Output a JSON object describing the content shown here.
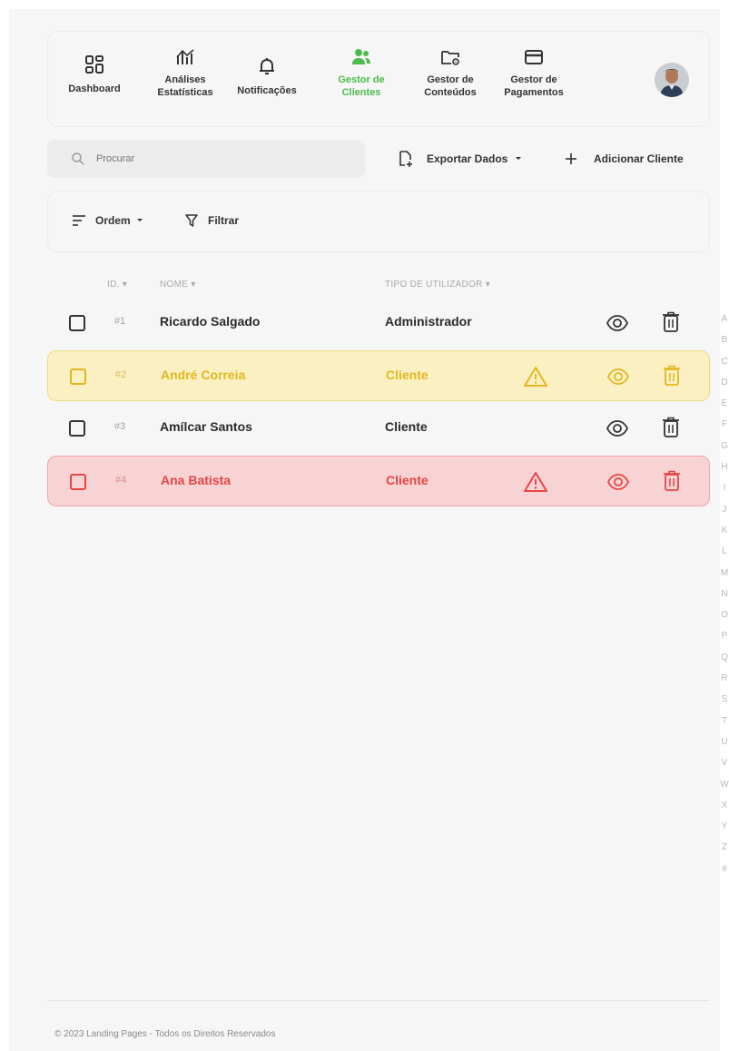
{
  "nav": {
    "items": [
      {
        "label_1": "Dashboard",
        "label_2": "",
        "icon": "dashboard-grid-icon",
        "active": false
      },
      {
        "label_1": "Análises",
        "label_2": "Estatísticas",
        "icon": "analytics-icon",
        "active": false
      },
      {
        "label_1": "Notificações",
        "label_2": "",
        "icon": "bell-icon",
        "active": false
      },
      {
        "label_1": "Gestor de",
        "label_2": "Clientes",
        "icon": "users-icon",
        "active": true
      },
      {
        "label_1": "Gestor de",
        "label_2": "Conteúdos",
        "icon": "folder-settings-icon",
        "active": false
      },
      {
        "label_1": "Gestor de",
        "label_2": "Pagamentos",
        "icon": "credit-card-icon",
        "active": false
      }
    ]
  },
  "toolbar": {
    "search_placeholder": "Procurar",
    "export_label": "Exportar Dados",
    "add_label": "Adicionar Cliente"
  },
  "filters": {
    "order_label": "Ordem",
    "filter_label": "Filtrar"
  },
  "table": {
    "headers": {
      "id": "ID.",
      "name": "NOME",
      "type": "TIPO DE UTILIZADOR"
    },
    "rows": [
      {
        "id": "#1",
        "name": "Ricardo Salgado",
        "type": "Administrador",
        "status": "normal",
        "warning": false
      },
      {
        "id": "#2",
        "name": "André Correia",
        "type": "Cliente",
        "status": "warning",
        "warning": true
      },
      {
        "id": "#3",
        "name": "Amílcar Santos",
        "type": "Cliente",
        "status": "normal",
        "warning": false
      },
      {
        "id": "#4",
        "name": "Ana Batista",
        "type": "Cliente",
        "status": "danger",
        "warning": true
      }
    ]
  },
  "alphabet": [
    "A",
    "B",
    "C",
    "D",
    "E",
    "F",
    "G",
    "H",
    "I",
    "J",
    "K",
    "L",
    "M",
    "N",
    "O",
    "P",
    "Q",
    "R",
    "S",
    "T",
    "U",
    "V",
    "W",
    "X",
    "Y",
    "Z",
    "#"
  ],
  "footer": {
    "text": "© 2023 Landing Pages - Todos os Direitos Reservados"
  },
  "colors": {
    "accent_active": "#4cbb4c",
    "warning": "#e2b820",
    "danger": "#e64545"
  }
}
